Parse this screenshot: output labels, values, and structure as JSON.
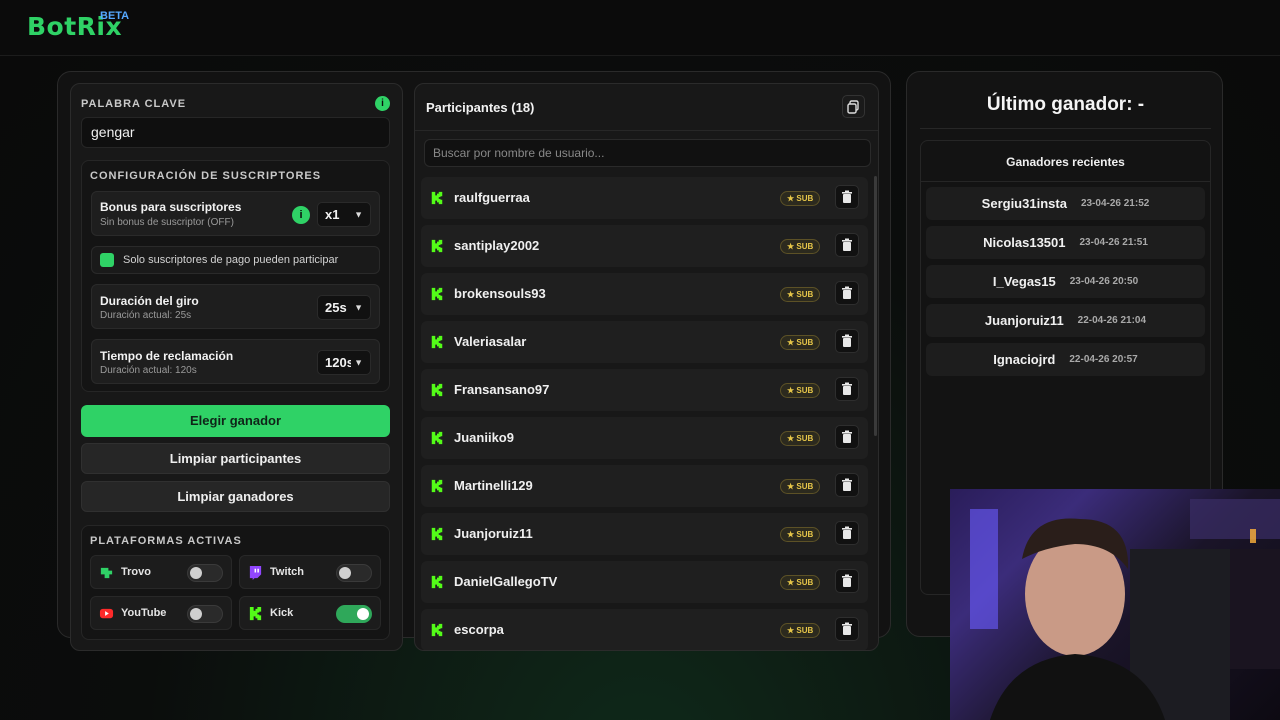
{
  "brand": {
    "name": "BotRix",
    "tag": "BETA"
  },
  "left": {
    "keyword_label": "PALABRA CLAVE",
    "keyword_value": "gengar",
    "sub_config_label": "CONFIGURACIÓN DE SUSCRIPTORES",
    "bonus": {
      "title": "Bonus para suscriptores",
      "subtitle": "Sin bonus de suscriptor (OFF)",
      "value": "x1"
    },
    "only_subs": {
      "label": "Solo suscriptores de pago pueden participar",
      "checked": true
    },
    "spin": {
      "title": "Duración del giro",
      "subtitle": "Duración actual: 25s",
      "value": "25s"
    },
    "claim": {
      "title": "Tiempo de reclamación",
      "subtitle": "Duración actual: 120s",
      "value": "120s"
    },
    "pick_winner": "Elegir ganador",
    "clear_participants": "Limpiar participantes",
    "clear_winners": "Limpiar ganadores",
    "platforms_label": "PLATAFORMAS ACTIVAS",
    "platforms": [
      {
        "name": "Trovo",
        "enabled": false
      },
      {
        "name": "Twitch",
        "enabled": false
      },
      {
        "name": "YouTube",
        "enabled": false
      },
      {
        "name": "Kick",
        "enabled": true
      }
    ]
  },
  "middle": {
    "title": "Participantes (18)",
    "search_placeholder": "Buscar por nombre de usuario...",
    "badge": "SUB",
    "participants": [
      "raulfguerraa",
      "santiplay2002",
      "brokensouls93",
      "Valeriasalar",
      "Fransansano97",
      "Juaniiko9",
      "Martinelli129",
      "Juanjoruiz11",
      "DanielGallegoTV",
      "escorpa"
    ]
  },
  "right": {
    "title": "Último ganador: -",
    "recent_title": "Ganadores recientes",
    "winners": [
      {
        "name": "Sergiu31insta",
        "date": "23-04-26 21:52"
      },
      {
        "name": "Nicolas13501",
        "date": "23-04-26 21:51"
      },
      {
        "name": "I_Vegas15",
        "date": "23-04-26 20:50"
      },
      {
        "name": "Juanjoruiz11",
        "date": "22-04-26 21:04"
      },
      {
        "name": "Ignaciojrd",
        "date": "22-04-26 20:57"
      }
    ]
  },
  "colors": {
    "accent": "#2fd266",
    "sub_badge": "#e6c649"
  }
}
